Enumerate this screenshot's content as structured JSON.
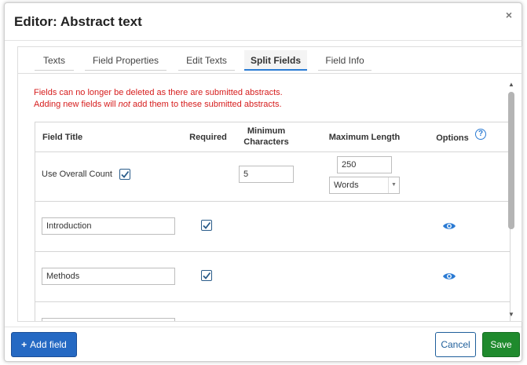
{
  "dialog": {
    "title": "Editor: Abstract text",
    "close_glyph": "×"
  },
  "tabs": [
    {
      "label": "Texts",
      "active": false
    },
    {
      "label": "Field Properties",
      "active": false
    },
    {
      "label": "Edit Texts",
      "active": false
    },
    {
      "label": "Split Fields",
      "active": true
    },
    {
      "label": "Field Info",
      "active": false
    }
  ],
  "warning": {
    "line1": "Fields can no longer be deleted as there are submitted abstracts.",
    "line2_pre": "Adding new fields will ",
    "line2_em": "not",
    "line2_post": " add them to these submitted abstracts."
  },
  "table": {
    "headers": {
      "field_title": "Field Title",
      "required": "Required",
      "minimum_line1": "Minimum",
      "minimum_line2": "Characters",
      "maximum_length": "Maximum Length",
      "options": "Options",
      "help_glyph": "?"
    },
    "overall": {
      "label": "Use Overall Count",
      "checked": true,
      "min_chars": "5",
      "max_length": "250",
      "unit": "Words"
    },
    "fields": [
      {
        "title": "Introduction",
        "required": true,
        "icon": "eye-icon"
      },
      {
        "title": "Methods",
        "required": true,
        "icon": "eye-icon"
      },
      {
        "title": "",
        "required": false,
        "icon": ""
      }
    ]
  },
  "footer": {
    "add_label": "Add field",
    "add_glyph": "+",
    "cancel_label": "Cancel",
    "save_label": "Save"
  },
  "colors": {
    "warning": "#d61d1d",
    "primary": "#2569c3",
    "save": "#1f8a2d",
    "checkbox": "#2a5c8a",
    "icon": "#2a7ad3"
  }
}
